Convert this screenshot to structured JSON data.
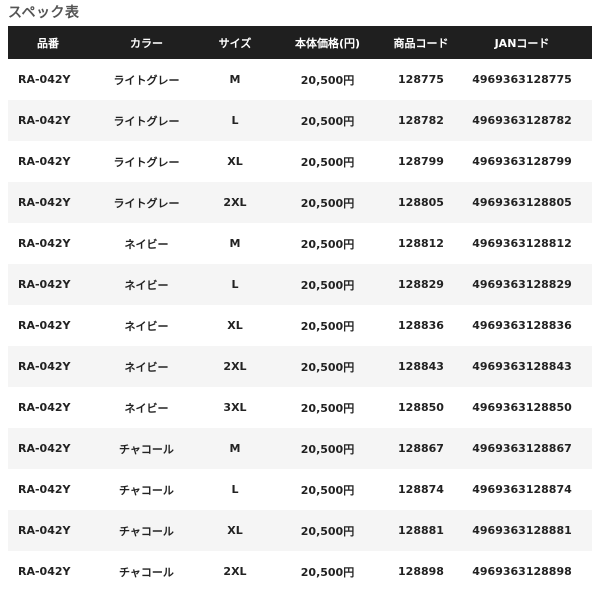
{
  "title": "スペック表",
  "columns": [
    "品番",
    "カラー",
    "サイズ",
    "本体価格(円)",
    "商品コード",
    "JANコード"
  ],
  "rows": [
    [
      "RA-042Y",
      "ライトグレー",
      "M",
      "20,500円",
      "128775",
      "4969363128775"
    ],
    [
      "RA-042Y",
      "ライトグレー",
      "L",
      "20,500円",
      "128782",
      "4969363128782"
    ],
    [
      "RA-042Y",
      "ライトグレー",
      "XL",
      "20,500円",
      "128799",
      "4969363128799"
    ],
    [
      "RA-042Y",
      "ライトグレー",
      "2XL",
      "20,500円",
      "128805",
      "4969363128805"
    ],
    [
      "RA-042Y",
      "ネイビー",
      "M",
      "20,500円",
      "128812",
      "4969363128812"
    ],
    [
      "RA-042Y",
      "ネイビー",
      "L",
      "20,500円",
      "128829",
      "4969363128829"
    ],
    [
      "RA-042Y",
      "ネイビー",
      "XL",
      "20,500円",
      "128836",
      "4969363128836"
    ],
    [
      "RA-042Y",
      "ネイビー",
      "2XL",
      "20,500円",
      "128843",
      "4969363128843"
    ],
    [
      "RA-042Y",
      "ネイビー",
      "3XL",
      "20,500円",
      "128850",
      "4969363128850"
    ],
    [
      "RA-042Y",
      "チャコール",
      "M",
      "20,500円",
      "128867",
      "4969363128867"
    ],
    [
      "RA-042Y",
      "チャコール",
      "L",
      "20,500円",
      "128874",
      "4969363128874"
    ],
    [
      "RA-042Y",
      "チャコール",
      "XL",
      "20,500円",
      "128881",
      "4969363128881"
    ],
    [
      "RA-042Y",
      "チャコール",
      "2XL",
      "20,500円",
      "128898",
      "4969363128898"
    ]
  ],
  "colors": {
    "header_bg": "#1f1f1f",
    "header_text": "#ffffff",
    "row_alt_bg": "#f5f5f5",
    "title_text": "#555555"
  }
}
